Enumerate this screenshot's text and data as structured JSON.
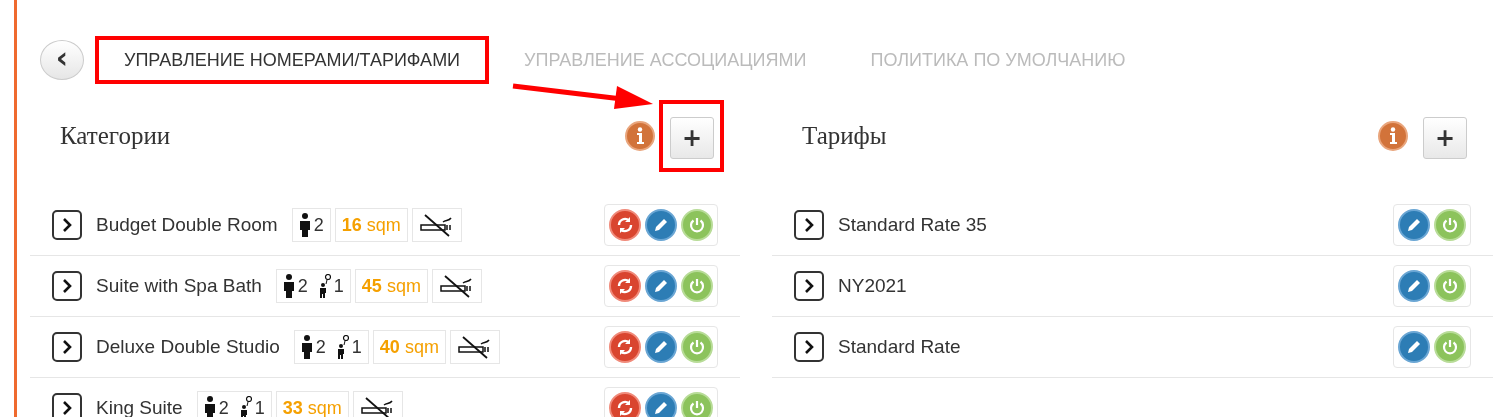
{
  "back_button": {
    "label": "‹"
  },
  "tabs": [
    {
      "label": "УПРАВЛЕНИЕ НОМЕРАМИ/ТАРИФАМИ",
      "selected": true,
      "highlighted": true
    },
    {
      "label": "УПРАВЛЕНИЕ АССОЦИАЦИЯМИ",
      "selected": false,
      "highlighted": false
    },
    {
      "label": "ПОЛИТИКА ПО УМОЛЧАНИЮ",
      "selected": false,
      "highlighted": false
    }
  ],
  "annotation_arrow": true,
  "panels": [
    {
      "title": "Категории",
      "add_label": "+",
      "add_highlighted": true,
      "rows": [
        {
          "name": "Budget Double Room",
          "adults": "2",
          "area": "16",
          "unit": "sqm",
          "non_smoking": true,
          "actions": [
            {
              "kind": "refresh"
            },
            {
              "kind": "edit"
            },
            {
              "kind": "power"
            }
          ]
        },
        {
          "name": "Suite with Spa Bath",
          "adults": "2",
          "children": "1",
          "area": "45",
          "unit": "sqm",
          "non_smoking": true,
          "actions": [
            {
              "kind": "refresh"
            },
            {
              "kind": "edit"
            },
            {
              "kind": "power"
            }
          ]
        },
        {
          "name": "Deluxe Double Studio",
          "adults": "2",
          "children": "1",
          "area": "40",
          "unit": "sqm",
          "non_smoking": true,
          "actions": [
            {
              "kind": "refresh"
            },
            {
              "kind": "edit"
            },
            {
              "kind": "power"
            }
          ]
        },
        {
          "name": "King Suite",
          "adults": "2",
          "children": "1",
          "area": "33",
          "unit": "sqm",
          "non_smoking": true,
          "actions": [
            {
              "kind": "refresh"
            },
            {
              "kind": "edit"
            },
            {
              "kind": "power"
            }
          ]
        }
      ]
    },
    {
      "title": "Тарифы",
      "add_label": "+",
      "add_highlighted": false,
      "rows": [
        {
          "name": "Standard Rate 35",
          "actions": [
            {
              "kind": "edit"
            },
            {
              "kind": "power"
            }
          ]
        },
        {
          "name": "NY2021",
          "actions": [
            {
              "kind": "edit"
            },
            {
              "kind": "power"
            }
          ]
        },
        {
          "name": "Standard Rate",
          "actions": [
            {
              "kind": "edit"
            },
            {
              "kind": "power"
            }
          ]
        }
      ]
    }
  ]
}
